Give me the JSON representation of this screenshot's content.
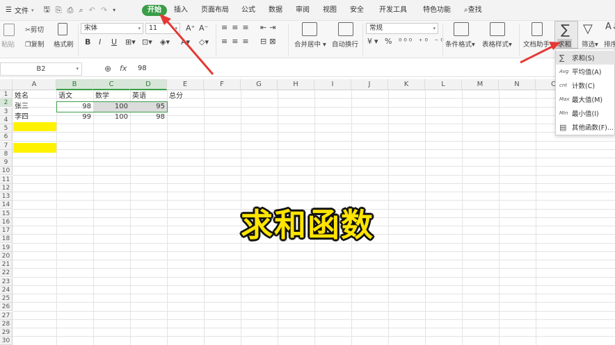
{
  "menubar": {
    "file_label": "文件",
    "tabs": [
      "开始",
      "插入",
      "页面布局",
      "公式",
      "数据",
      "审阅",
      "视图",
      "安全",
      "开发工具",
      "特色功能"
    ],
    "search_label": "查找"
  },
  "ribbon": {
    "paste": "粘贴",
    "cut": "剪切",
    "copy": "复制",
    "format_painter": "格式刷",
    "font_name": "宋体",
    "font_size": "11",
    "merge_center": "合并居中",
    "wrap_text": "自动换行",
    "number_format": "常规",
    "conditional_format": "条件格式",
    "table_style": "表格样式",
    "doc_assistant": "文档助手",
    "sum": "求和",
    "filter": "筛选",
    "sort": "排序"
  },
  "formula_bar": {
    "name_box": "B2",
    "fx": "fx",
    "value": "98"
  },
  "columns": [
    "A",
    "B",
    "C",
    "D",
    "E",
    "F",
    "G",
    "H",
    "I",
    "J",
    "K",
    "L",
    "M",
    "N",
    "O"
  ],
  "rows": [
    "1",
    "2",
    "3",
    "4",
    "5",
    "6",
    "7",
    "8",
    "9",
    "10",
    "11",
    "12",
    "13",
    "14",
    "15",
    "16",
    "17",
    "18",
    "19",
    "20",
    "21",
    "22",
    "23",
    "24",
    "25",
    "26",
    "27",
    "28",
    "29",
    "30"
  ],
  "cells": {
    "A1": "姓名",
    "B1": "语文",
    "C1": "数学",
    "D1": "英语",
    "E1": "总分",
    "A2": "张三",
    "B2": "98",
    "C2": "100",
    "D2": "95",
    "A3": "李四",
    "B3": "99",
    "C3": "100",
    "D3": "98"
  },
  "dropdown": {
    "items": [
      {
        "icon": "sum-icon",
        "glyph": "∑",
        "label": "求和(S)"
      },
      {
        "icon": "avg-icon",
        "glyph": "Avg",
        "label": "平均值(A)"
      },
      {
        "icon": "cnt-icon",
        "glyph": "cnt",
        "label": "计数(C)"
      },
      {
        "icon": "max-icon",
        "glyph": "Max",
        "label": "最大值(M)"
      },
      {
        "icon": "min-icon",
        "glyph": "Min",
        "label": "最小值(I)"
      },
      {
        "icon": "more-functions-icon",
        "glyph": "▤",
        "label": "其他函数(F)..."
      }
    ]
  },
  "overlay_caption": "求和函数",
  "colors": {
    "accent": "#3a9e48",
    "highlight_fill": "#fff200",
    "arrow": "#e53935"
  }
}
